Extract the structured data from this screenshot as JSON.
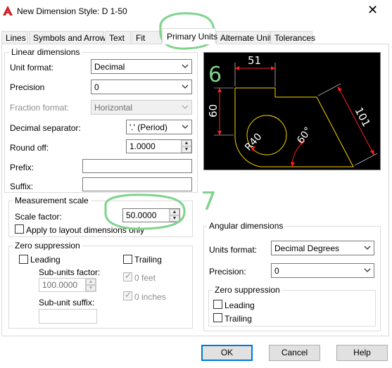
{
  "window": {
    "title": "New Dimension Style: D 1-50",
    "close_glyph": "✕"
  },
  "tabs": [
    {
      "label": "Lines"
    },
    {
      "label": "Symbols and Arrows"
    },
    {
      "label": "Text"
    },
    {
      "label": "Fit"
    },
    {
      "label": "Primary Units"
    },
    {
      "label": "Alternate Units"
    },
    {
      "label": "Tolerances"
    }
  ],
  "active_tab": "Primary Units",
  "linear": {
    "group_title": "Linear dimensions",
    "unit_format_label": "Unit format:",
    "unit_format_value": "Decimal",
    "precision_label": "Precision",
    "precision_value": "0",
    "fraction_format_label": "Fraction format:",
    "fraction_format_value": "Horizontal",
    "decimal_separator_label": "Decimal separator:",
    "decimal_separator_value": "'.' (Period)",
    "round_off_label": "Round off:",
    "round_off_value": "1.0000",
    "prefix_label": "Prefix:",
    "prefix_value": "",
    "suffix_label": "Suffix:",
    "suffix_value": ""
  },
  "measurement_scale": {
    "group_title": "Measurement scale",
    "scale_factor_label": "Scale factor:",
    "scale_factor_value": "50.0000",
    "apply_layout_label": "Apply to layout dimensions only",
    "apply_layout_checked": false
  },
  "zero_suppression_linear": {
    "group_title": "Zero suppression",
    "leading_label": "Leading",
    "trailing_label": "Trailing",
    "sub_units_factor_label": "Sub-units factor:",
    "sub_units_factor_value": "100.0000",
    "feet_label": "0 feet",
    "inches_label": "0 inches",
    "sub_unit_suffix_label": "Sub-unit suffix:",
    "sub_unit_suffix_value": ""
  },
  "angular": {
    "group_title": "Angular dimensions",
    "units_format_label": "Units format:",
    "units_format_value": "Decimal Degrees",
    "precision_label": "Precision:",
    "precision_value": "0",
    "zero_suppression_title": "Zero suppression",
    "leading_label": "Leading",
    "trailing_label": "Trailing"
  },
  "preview": {
    "dim_51": "51",
    "dim_60": "60",
    "dim_101": "101",
    "dim_r40": "R40",
    "dim_60deg": "60°"
  },
  "annotations": {
    "step_6": "6",
    "step_7": "7"
  },
  "buttons": {
    "ok": "OK",
    "cancel": "Cancel",
    "help": "Help"
  }
}
